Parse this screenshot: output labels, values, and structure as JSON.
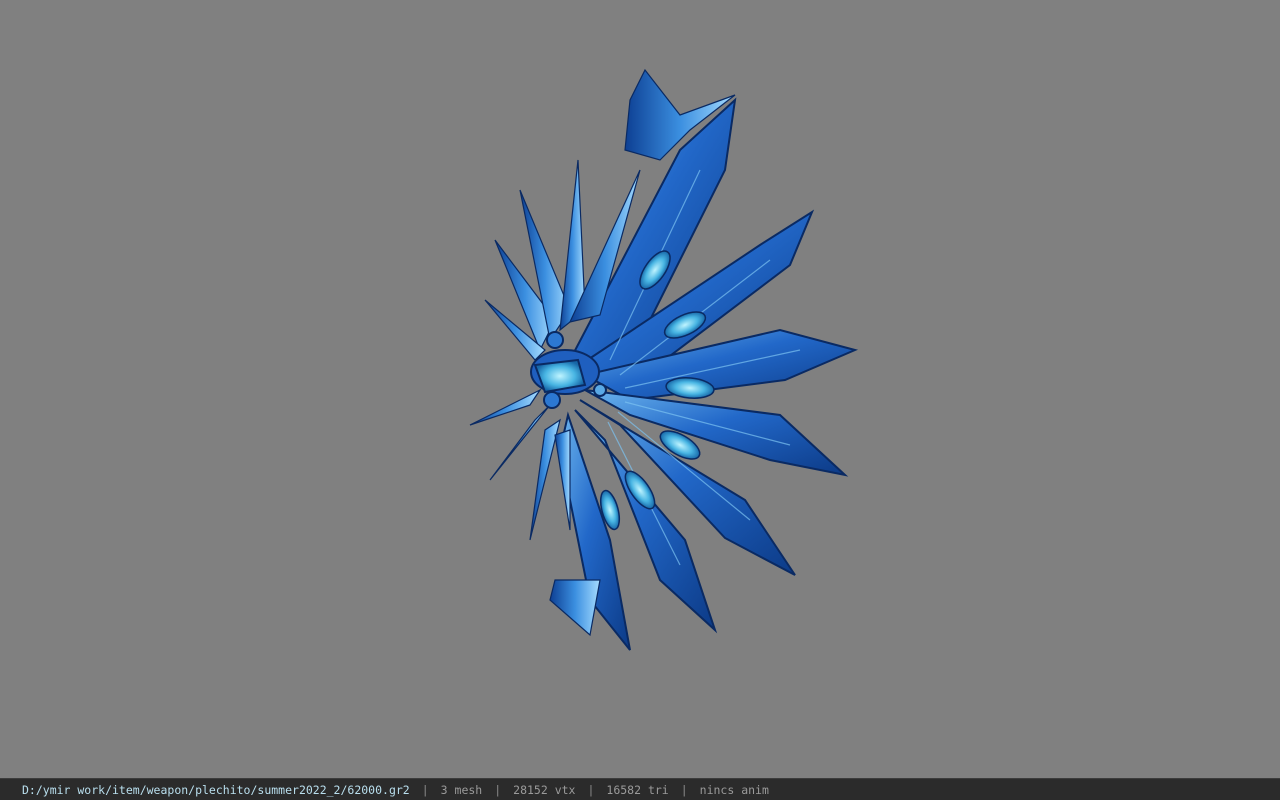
{
  "viewer": {
    "background_color": "#808080",
    "model_icon": "blue-fan-weapon-model",
    "model_colors": {
      "primary": "#1f5fbf",
      "light": "#5aa9e6",
      "dark": "#0c2f6e",
      "highlight": "#9fe3ff"
    }
  },
  "status_bar": {
    "file_path": "D:/ymir work/item/weapon/plechito/summer2022_2/62000.gr2",
    "separator": "|",
    "mesh_count": "3 mesh",
    "vertex_count": "28152 vtx",
    "triangle_count": "16582 tri",
    "anim_status": "nincs anim"
  }
}
